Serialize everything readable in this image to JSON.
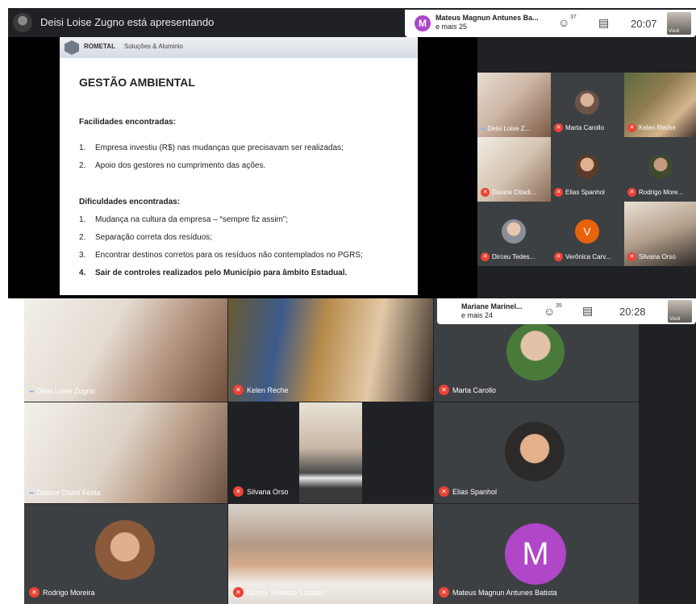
{
  "top": {
    "presenting_text": "Deisi Loise Zugno está apresentando",
    "info": {
      "avatar_letter": "M",
      "name": "Mateus Magnun Antunes Ba...",
      "more": "e mais 25",
      "people_count": "37",
      "time": "20:07",
      "you_label": "Você"
    },
    "slide": {
      "brand": "ROMETAL",
      "brand_sub": "Soluções & Aluminio",
      "title": "GESTÃO AMBIENTAL",
      "section1": "Facilidades encontradas:",
      "items1": [
        {
          "n": "1.",
          "t": "Empresa investiu (R$) nas mudanças que precisavam ser realizadas;"
        },
        {
          "n": "2.",
          "t": "Apoio dos gestores no cumprimento das ações."
        }
      ],
      "section2": "Dificuldades encontradas:",
      "items2": [
        {
          "n": "1.",
          "t": "Mudança na cultura da empresa – “sempre fiz assim”;"
        },
        {
          "n": "2.",
          "t": "Separação correta dos resíduos;"
        },
        {
          "n": "3.",
          "t": "Encontrar destinos corretos para os resíduos não contemplados no PGRS;"
        },
        {
          "n": "4.",
          "t": "Sair de controles realizados pelo Município para âmbito Estadual."
        }
      ]
    },
    "participants": [
      {
        "name": "Deisi Loise Z...",
        "muted": false
      },
      {
        "name": "Marta Carollo",
        "muted": true
      },
      {
        "name": "Kelen Reche",
        "muted": true
      },
      {
        "name": "Daiane Ditadi...",
        "muted": true
      },
      {
        "name": "Elias Spanhol",
        "muted": true
      },
      {
        "name": "Rodrigo More...",
        "muted": true
      },
      {
        "name": "Dirceu Tedes...",
        "muted": true
      },
      {
        "name": "Verônica Carv...",
        "muted": true,
        "avatar_letter": "V"
      },
      {
        "name": "Silvana Orso",
        "muted": true
      }
    ]
  },
  "bottom": {
    "info": {
      "name": "Mariane Marinel...",
      "more": "e mais 24",
      "people_count": "35",
      "time": "20:28",
      "you_label": "Você"
    },
    "participants": [
      {
        "name": "Deisi Loise Zugno",
        "muted": false
      },
      {
        "name": "Kelen Reche",
        "muted": true
      },
      {
        "name": "Marta Carollo",
        "muted": true
      },
      {
        "name": "Daiane Ditadi Festa",
        "muted": false
      },
      {
        "name": "Silvana Orso",
        "muted": true
      },
      {
        "name": "Elias Spanhol",
        "muted": true
      },
      {
        "name": "Rodrigo Moreira",
        "muted": true
      },
      {
        "name": "Dirceu Tedesco 'Locutor'",
        "muted": true
      },
      {
        "name": "Mateus Magnun Antunes Batista",
        "muted": true,
        "avatar_letter": "M"
      }
    ]
  },
  "colors": {
    "background": "#202124",
    "muted": "#ea4335",
    "avatar_purple": "#b046c8",
    "avatar_orange": "#e8630a"
  }
}
